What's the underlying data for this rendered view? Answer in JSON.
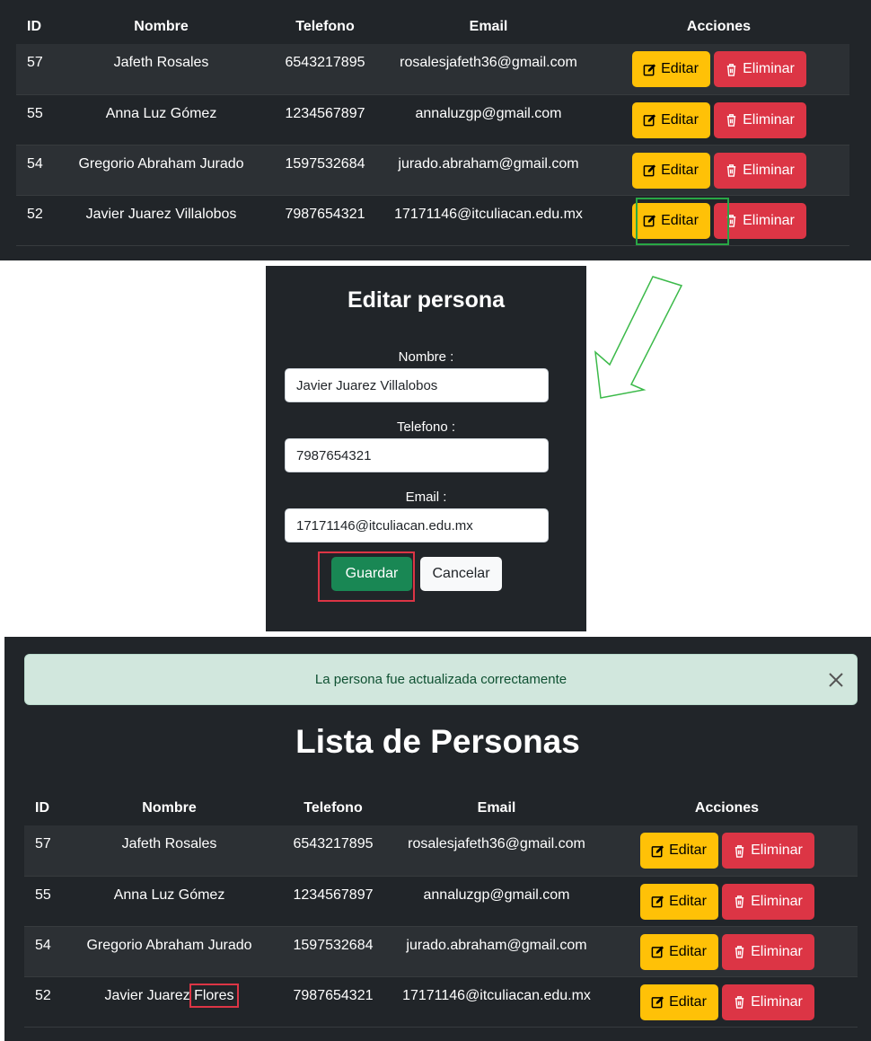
{
  "columns": [
    "ID",
    "Nombre",
    "Telefono",
    "Email",
    "Acciones"
  ],
  "buttons": {
    "edit": "Editar",
    "delete": "Eliminar"
  },
  "table_before": [
    {
      "id": "57",
      "nombre": "Jafeth Rosales",
      "telefono": "6543217895",
      "email": "rosalesjafeth36@gmail.com"
    },
    {
      "id": "55",
      "nombre": "Anna Luz Gómez",
      "telefono": "1234567897",
      "email": "annaluzgp@gmail.com"
    },
    {
      "id": "54",
      "nombre": "Gregorio Abraham Jurado",
      "telefono": "1597532684",
      "email": "jurado.abraham@gmail.com"
    },
    {
      "id": "52",
      "nombre": "Javier Juarez Villalobos",
      "telefono": "7987654321",
      "email": "17171146@itculiacan.edu.mx"
    }
  ],
  "modal": {
    "title": "Editar persona",
    "nombre_label": "Nombre :",
    "nombre_value": "Javier Juarez Villalobos",
    "telefono_label": "Telefono :",
    "telefono_value": "7987654321",
    "email_label": "Email :",
    "email_value": "17171146@itculiacan.edu.mx",
    "save": "Guardar",
    "cancel": "Cancelar"
  },
  "alert": {
    "message": "La persona fue actualizada correctamente"
  },
  "list_title": "Lista de Personas",
  "table_after": [
    {
      "id": "57",
      "nombre": "Jafeth Rosales",
      "telefono": "6543217895",
      "email": "rosalesjafeth36@gmail.com"
    },
    {
      "id": "55",
      "nombre": "Anna Luz Gómez",
      "telefono": "1234567897",
      "email": "annaluzgp@gmail.com"
    },
    {
      "id": "54",
      "nombre": "Gregorio Abraham Jurado",
      "telefono": "1597532684",
      "email": "jurado.abraham@gmail.com"
    },
    {
      "id": "52",
      "nombre_prefix": "Javier Juarez",
      "nombre_highlight": "Flores",
      "telefono": "7987654321",
      "email": "17171146@itculiacan.edu.mx"
    }
  ],
  "colors": {
    "edit": "#ffc107",
    "delete": "#dc3545",
    "save": "#198754",
    "highlight_green": "#28a745",
    "highlight_red": "#dc3545",
    "panel_bg": "#212529"
  },
  "icons": {
    "edit": "pencil-square-icon",
    "delete": "trash-icon",
    "close": "close-icon"
  }
}
